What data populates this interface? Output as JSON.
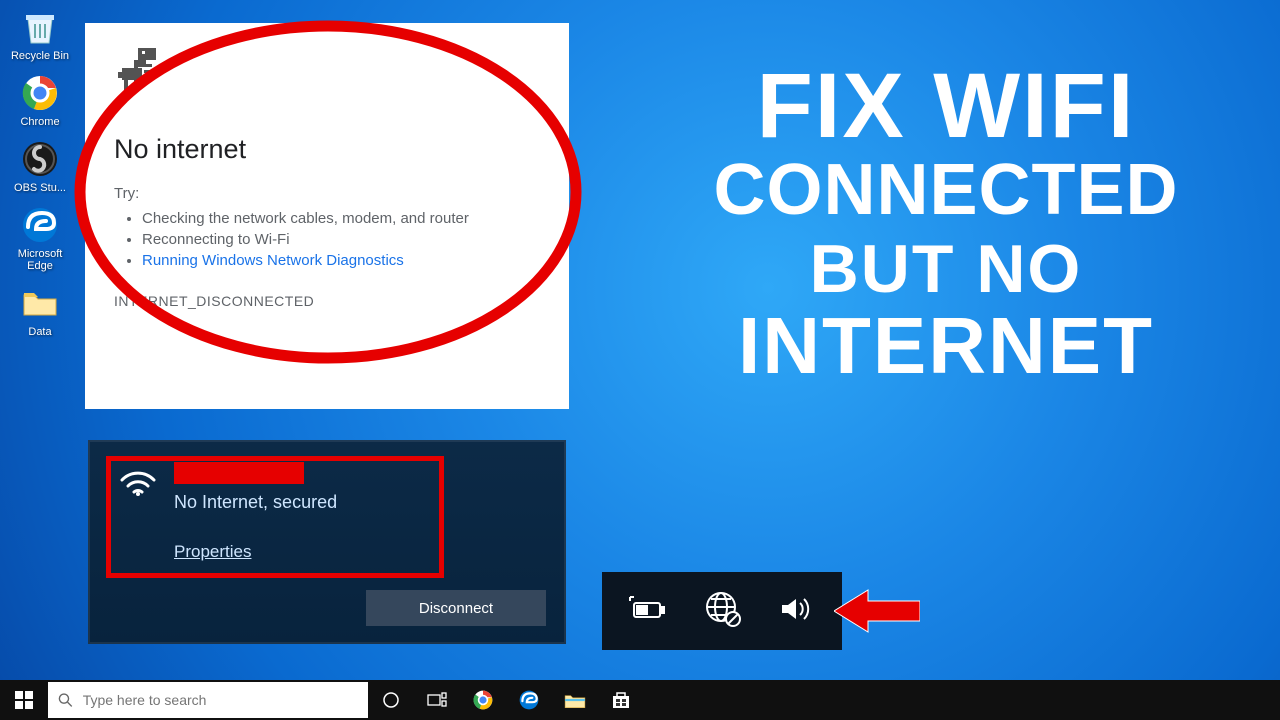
{
  "desktop_icons": {
    "recycle": "Recycle Bin",
    "chrome": "Chrome",
    "obs": "OBS Stu...",
    "edge": "Microsoft Edge",
    "data": "Data"
  },
  "chrome_error": {
    "title": "No internet",
    "try_label": "Try:",
    "bullets": {
      "b1": "Checking the network cables, modem, and router",
      "b2": "Reconnecting to Wi-Fi",
      "b3": "Running Windows Network Diagnostics"
    },
    "error_code": "INTERNET_DISCONNECTED"
  },
  "wifi_flyout": {
    "status": "No Internet, secured",
    "properties_link": "Properties",
    "disconnect_btn": "Disconnect"
  },
  "headline": {
    "line1": "FIX WIFI",
    "line2": "CONNECTED",
    "line3": "BUT NO",
    "line4": "INTERNET"
  },
  "taskbar": {
    "search_placeholder": "Type here to search"
  }
}
